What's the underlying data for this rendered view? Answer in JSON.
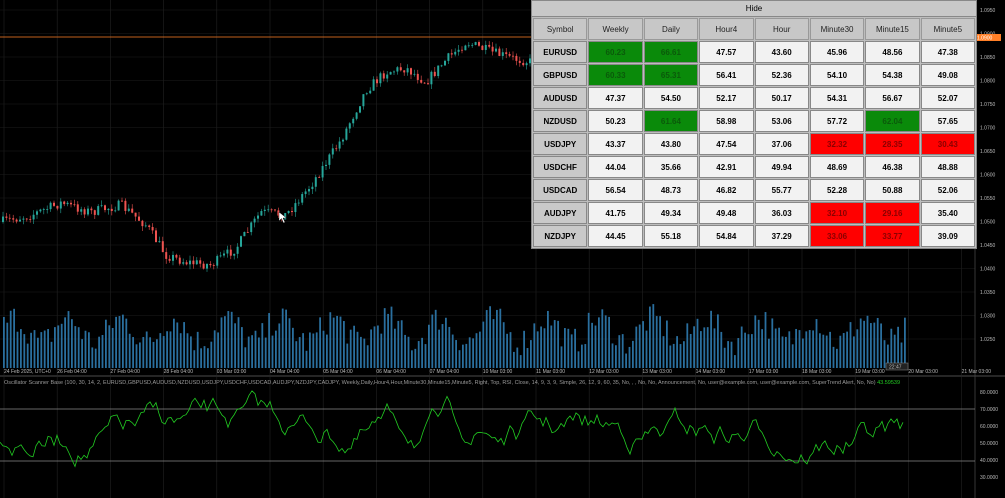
{
  "scanner": {
    "hide_label": "Hide",
    "columns": [
      "Symbol",
      "Weekly",
      "Daily",
      "Hour4",
      "Hour",
      "Minute30",
      "Minute15",
      "Minute5"
    ],
    "rows": [
      {
        "symbol": "EURUSD",
        "values": [
          "60.23",
          "66.61",
          "47.57",
          "43.60",
          "45.96",
          "48.56",
          "47.38"
        ],
        "states": [
          "g",
          "g",
          "",
          "",
          "",
          "",
          ""
        ]
      },
      {
        "symbol": "GBPUSD",
        "values": [
          "60.33",
          "65.31",
          "56.41",
          "52.36",
          "54.10",
          "54.38",
          "49.08"
        ],
        "states": [
          "g",
          "g",
          "",
          "",
          "",
          "",
          ""
        ]
      },
      {
        "symbol": "AUDUSD",
        "values": [
          "47.37",
          "54.50",
          "52.17",
          "50.17",
          "54.31",
          "56.67",
          "52.07"
        ],
        "states": [
          "",
          "",
          "",
          "",
          "",
          "",
          ""
        ]
      },
      {
        "symbol": "NZDUSD",
        "values": [
          "50.23",
          "61.64",
          "58.98",
          "53.06",
          "57.72",
          "62.04",
          "57.65"
        ],
        "states": [
          "",
          "g",
          "",
          "",
          "",
          "g",
          ""
        ]
      },
      {
        "symbol": "USDJPY",
        "values": [
          "43.37",
          "43.80",
          "47.54",
          "37.06",
          "32.32",
          "28.35",
          "30.43"
        ],
        "states": [
          "",
          "",
          "",
          "",
          "r",
          "r",
          "r"
        ]
      },
      {
        "symbol": "USDCHF",
        "values": [
          "44.04",
          "35.66",
          "42.91",
          "49.94",
          "48.69",
          "46.38",
          "48.88"
        ],
        "states": [
          "",
          "",
          "",
          "",
          "",
          "",
          ""
        ]
      },
      {
        "symbol": "USDCAD",
        "values": [
          "56.54",
          "48.73",
          "46.82",
          "55.77",
          "52.28",
          "50.88",
          "52.06"
        ],
        "states": [
          "",
          "",
          "",
          "",
          "",
          "",
          ""
        ]
      },
      {
        "symbol": "AUDJPY",
        "values": [
          "41.75",
          "49.34",
          "49.48",
          "36.03",
          "32.10",
          "29.16",
          "35.40"
        ],
        "states": [
          "",
          "",
          "",
          "",
          "r",
          "r",
          ""
        ]
      },
      {
        "symbol": "NZDJPY",
        "values": [
          "44.45",
          "55.18",
          "54.84",
          "37.29",
          "33.06",
          "33.77",
          "39.09"
        ],
        "states": [
          "",
          "",
          "",
          "",
          "r",
          "r",
          ""
        ]
      }
    ]
  },
  "price_axis": [
    "1.0950",
    "1.0900",
    "1.0850",
    "1.0800",
    "1.0750",
    "1.0700",
    "1.0650",
    "1.0600",
    "1.0550",
    "1.0500",
    "1.0450",
    "1.0400",
    "1.0350",
    "1.0300",
    "1.0250"
  ],
  "current_price_tag": "1.0900",
  "time_axis": [
    "24 Feb 2025, UTC+0",
    "26 Feb 04:00",
    "27 Feb 04:00",
    "28 Feb 04:00",
    "03 Mar 03:00",
    "04 Mar 04:00",
    "05 Mar 04:00",
    "06 Mar 04:00",
    "07 Mar 04:00",
    "10 Mar 03:00",
    "11 Mar 03:00",
    "12 Mar 03:00",
    "13 Mar 03:00",
    "14 Mar 03:00",
    "17 Mar 03:00",
    "18 Mar 03:00",
    "19 Mar 03:00",
    "20 Mar 03:00",
    "21 Mar 03:00"
  ],
  "time_cursor": "22:47",
  "indicator": {
    "title": "Oscillator Scanner Base (100, 30, 14, 2, EURUSD,GBPUSD,AUDUSD,NZDUSD,USDJPY,USDCHF,USDCAD,AUDJPY,NZDJPY,CADJPY, Weekly,Daily,Hour4,Hour,Minute30,Minute15,Minute5, Right, Top, RSI, Close, 14, 9, 3, 9, Simple, 26, 12, 9, 60, 35, No, , , No, No, Announcement, No, user@example.com, user@example.com, SuperTrend Alert, No, No)",
    "value": "43.59539",
    "axis": [
      "80.0000",
      "70.0000",
      "60.0000",
      "50.0000",
      "40.0000",
      "30.0000"
    ]
  },
  "colors": {
    "bull": "#26a69a",
    "bear": "#ef5350",
    "volume": "#2a6f9e",
    "oscillator": "#22cc22",
    "price_line": "#ff7f27",
    "cell_green": "#0a8a0a",
    "cell_red": "#ff0000"
  }
}
